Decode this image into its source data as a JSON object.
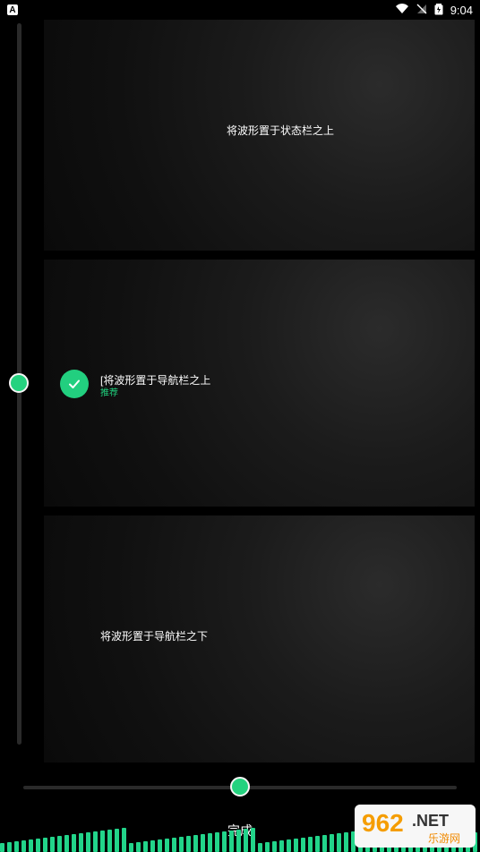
{
  "status_bar": {
    "app_badge": "A",
    "time": "9:04"
  },
  "cards": {
    "top": {
      "title": "将波形置于状态栏之上"
    },
    "middle": {
      "title": "[将波形置于导航栏之上",
      "subtitle": "推荐"
    },
    "bottom": {
      "title": "将波形置于导航栏之下"
    }
  },
  "controls": {
    "done_label": "完成"
  },
  "colors": {
    "accent": "#24d27f",
    "background": "#000000",
    "card_dark": "#101010",
    "track": "#2a2a2a",
    "white": "#ffffff"
  },
  "icons": {
    "wifi": "wifi-icon",
    "signal_off": "signal-off-icon",
    "battery": "battery-icon",
    "check": "check-icon"
  },
  "watermark": {
    "big_text": "962.NET",
    "small_text": "乐游网"
  }
}
